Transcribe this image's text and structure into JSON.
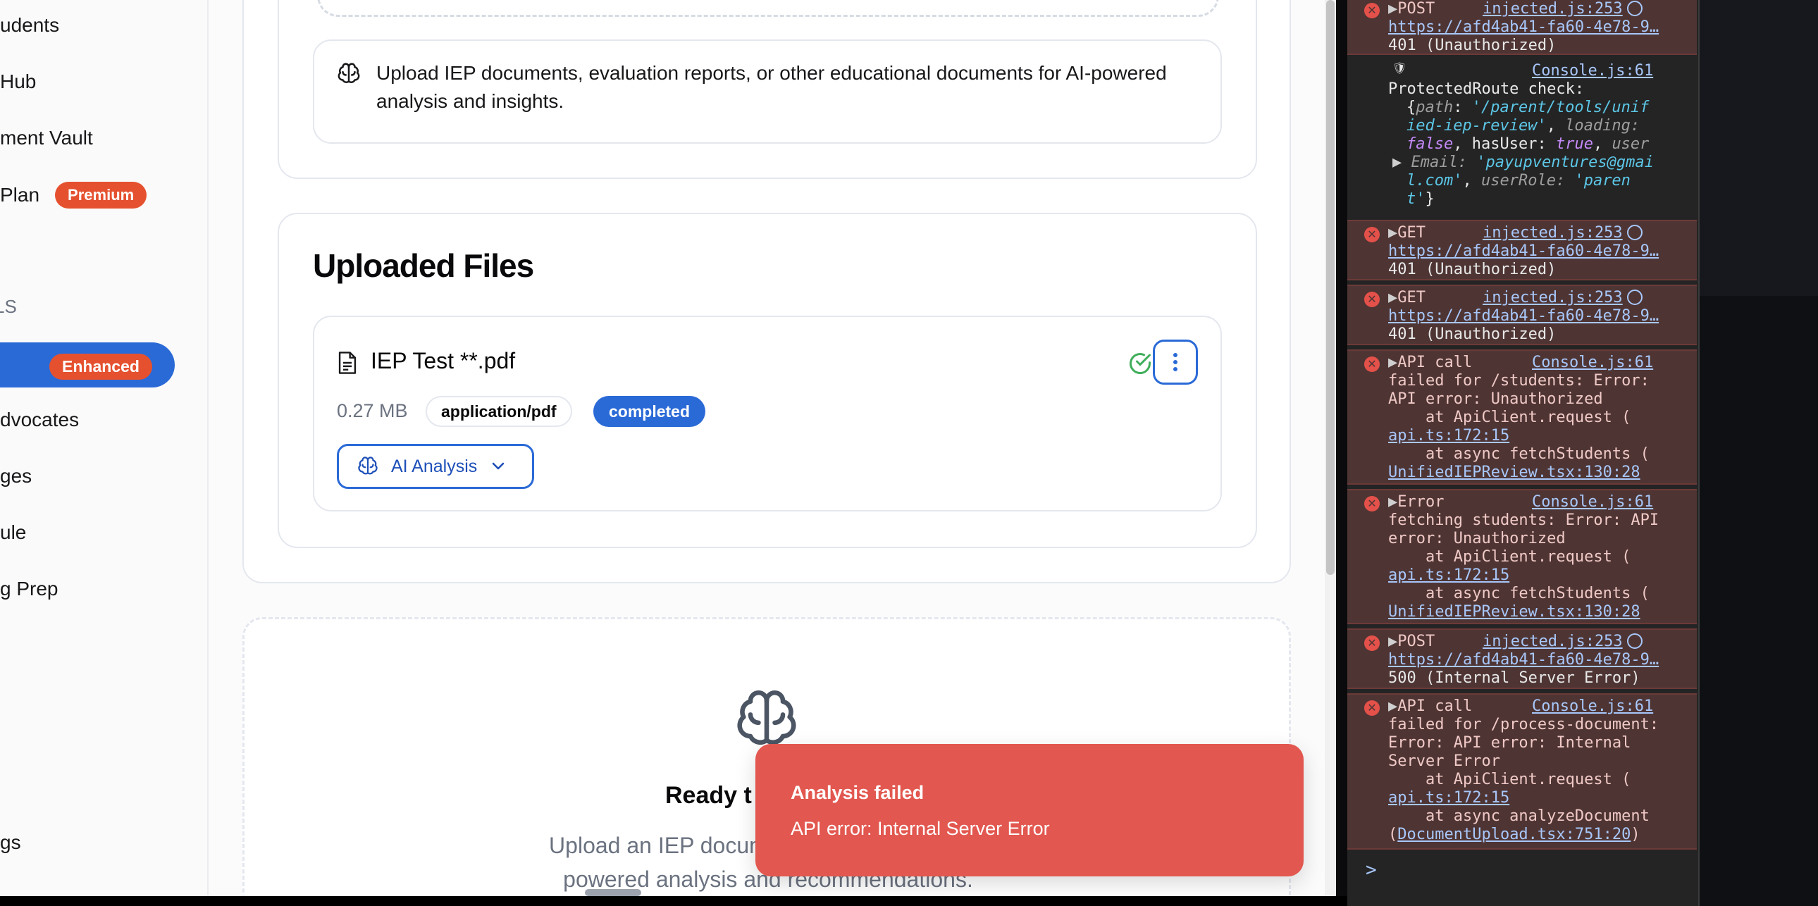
{
  "sidebar": {
    "items": [
      {
        "label": "udents"
      },
      {
        "label": "Hub"
      },
      {
        "label": "ment Vault"
      },
      {
        "label": "Plan",
        "badge": "Premium"
      },
      {
        "label": "dvocates"
      },
      {
        "label": "ges"
      },
      {
        "label": "ule"
      },
      {
        "label": "g Prep"
      },
      {
        "label": "gs"
      }
    ],
    "section_label": "LS",
    "active_badge": "Enhanced"
  },
  "upload": {
    "info_text": "Upload IEP documents, evaluation reports, or other educational documents for AI-powered analysis and insights."
  },
  "files": {
    "title": "Uploaded Files",
    "items": [
      {
        "name": "IEP Test **.pdf",
        "size": "0.27 MB",
        "type": "application/pdf",
        "status": "completed",
        "action_label": "AI Analysis"
      }
    ]
  },
  "ready": {
    "title": "Ready t",
    "desc_line1": "Upload an IEP document a",
    "desc_line2": "powered analysis and recommendations."
  },
  "toast": {
    "title": "Analysis failed",
    "message": "API error: Internal Server Error"
  },
  "console": {
    "e1": {
      "l1": "POST",
      "src": "injected.js:253",
      "l2": "https://afd4ab41-fa60-4e78-9…",
      "l3": "401 (Unauthorized)"
    },
    "e2": {
      "src": "Console.js:61",
      "l1": "ProtectedRoute check:",
      "k_path": "path",
      "v_path_a": "'/parent/tools/unif",
      "v_path_b": "ied-iep-review'",
      "k_loading": "loading",
      "v_false": "false",
      "k_hasuser": "hasUser",
      "v_true": "true",
      "k_user": "user",
      "k_email": "Email",
      "v_email_a": "'payupventures@gmai",
      "v_email_b": "l.com'",
      "k_role": "userRole",
      "v_role_a": "'paren",
      "v_role_b": "t'"
    },
    "e3": {
      "l1": "GET",
      "src": "injected.js:253",
      "l2": "https://afd4ab41-fa60-4e78-9…",
      "l3": "401 (Unauthorized)"
    },
    "e4": {
      "l1": "GET",
      "src": "injected.js:253",
      "l2": "https://afd4ab41-fa60-4e78-9…",
      "l3": "401 (Unauthorized)"
    },
    "e5": {
      "l1": "API call",
      "src": "Console.js:61",
      "l2": "failed for /students: Error:",
      "l3": "API error: Unauthorized",
      "l4": "    at ApiClient.request (",
      "l5": "api.ts:172:15",
      "l6": "    at async fetchStudents (",
      "l7": "UnifiedIEPReview.tsx:130:28"
    },
    "e6": {
      "l1": "Error",
      "src": "Console.js:61",
      "l2": "fetching students: Error: API",
      "l3": "error: Unauthorized",
      "l4": "    at ApiClient.request (",
      "l5": "api.ts:172:15",
      "l6": "    at async fetchStudents (",
      "l7": "UnifiedIEPReview.tsx:130:28"
    },
    "e7": {
      "l1": "POST",
      "src": "injected.js:253",
      "l2": "https://afd4ab41-fa60-4e78-9…",
      "l3": "500 (Internal Server Error)"
    },
    "e8": {
      "l1": "API call",
      "src": "Console.js:61",
      "l2": "failed for /process-document:",
      "l3": "Error: API error: Internal",
      "l4": "Server Error",
      "l5": "    at ApiClient.request (",
      "l6": "api.ts:172:15",
      "l7": "    at async analyzeDocument",
      "l8a": "(",
      "l8b": "DocumentUpload.tsx:751:20",
      "l8c": ")"
    },
    "prompt": ">"
  }
}
